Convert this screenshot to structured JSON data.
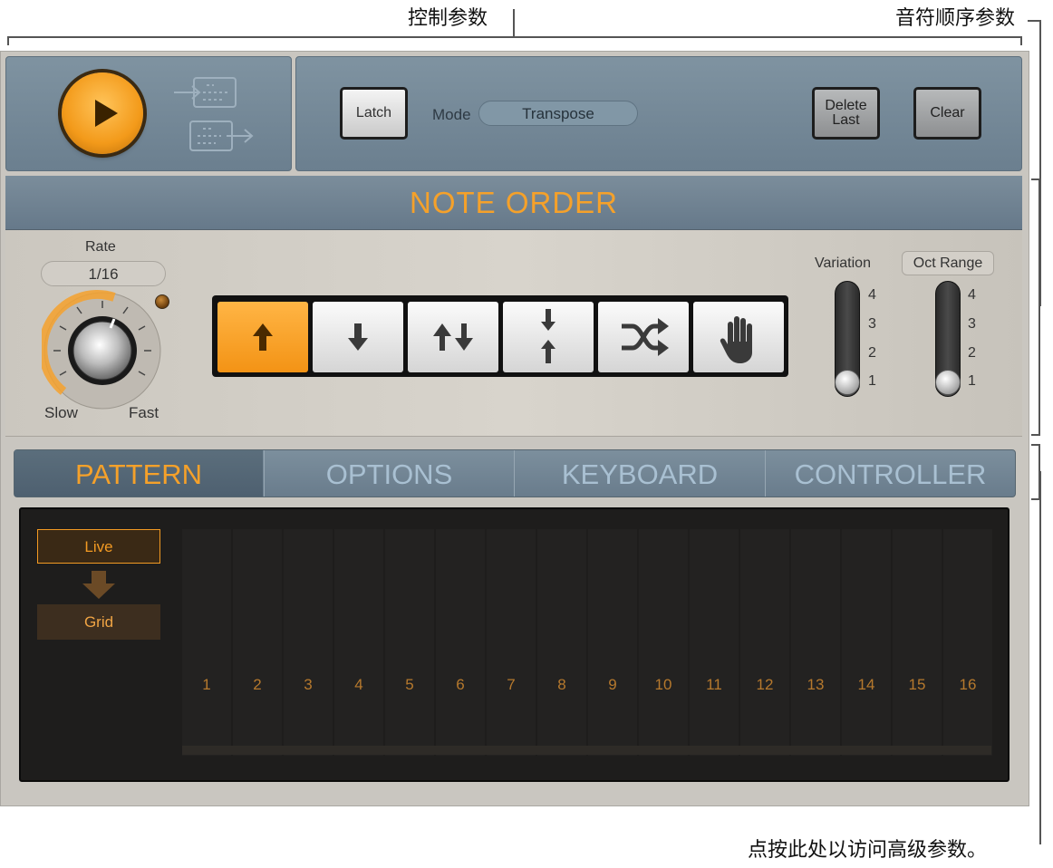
{
  "callouts": {
    "control_params": "控制参数",
    "note_order_params": "音符顺序参数",
    "advanced_params": "点按此处以访问高级参数。"
  },
  "transport": {
    "play_icon": "play-icon",
    "capture_in_icon": "capture-in-icon",
    "capture_out_icon": "capture-out-icon"
  },
  "controls": {
    "latch_label": "Latch",
    "mode_label": "Mode",
    "mode_value": "Transpose",
    "delete_last_line1": "Delete",
    "delete_last_line2": "Last",
    "clear_label": "Clear"
  },
  "note_order": {
    "title": "NOTE ORDER",
    "rate_label": "Rate",
    "rate_value": "1/16",
    "slow_label": "Slow",
    "fast_label": "Fast",
    "buttons": [
      {
        "icon": "arrow-up-icon",
        "active": true
      },
      {
        "icon": "arrow-down-icon",
        "active": false
      },
      {
        "icon": "up-down-arrows-icon",
        "active": false
      },
      {
        "icon": "outside-in-arrows-icon",
        "active": false
      },
      {
        "icon": "shuffle-icon",
        "active": false
      },
      {
        "icon": "hand-icon",
        "active": false
      }
    ],
    "variation_label": "Variation",
    "variation_value": 1,
    "oct_range_label": "Oct Range",
    "oct_range_value": 1,
    "scale": [
      "4",
      "3",
      "2",
      "1"
    ]
  },
  "tabs": [
    {
      "label": "PATTERN",
      "active": true
    },
    {
      "label": "OPTIONS",
      "active": false
    },
    {
      "label": "KEYBOARD",
      "active": false
    },
    {
      "label": "CONTROLLER",
      "active": false
    }
  ],
  "pattern": {
    "live_label": "Live",
    "grid_label": "Grid",
    "steps": [
      "1",
      "2",
      "3",
      "4",
      "5",
      "6",
      "7",
      "8",
      "9",
      "10",
      "11",
      "12",
      "13",
      "14",
      "15",
      "16"
    ]
  },
  "colors": {
    "accent": "#f5a12a",
    "panel_blue": "#6b7f8f",
    "panel_gray": "#c9c6c0",
    "grid_bg": "#1e1d1c"
  }
}
